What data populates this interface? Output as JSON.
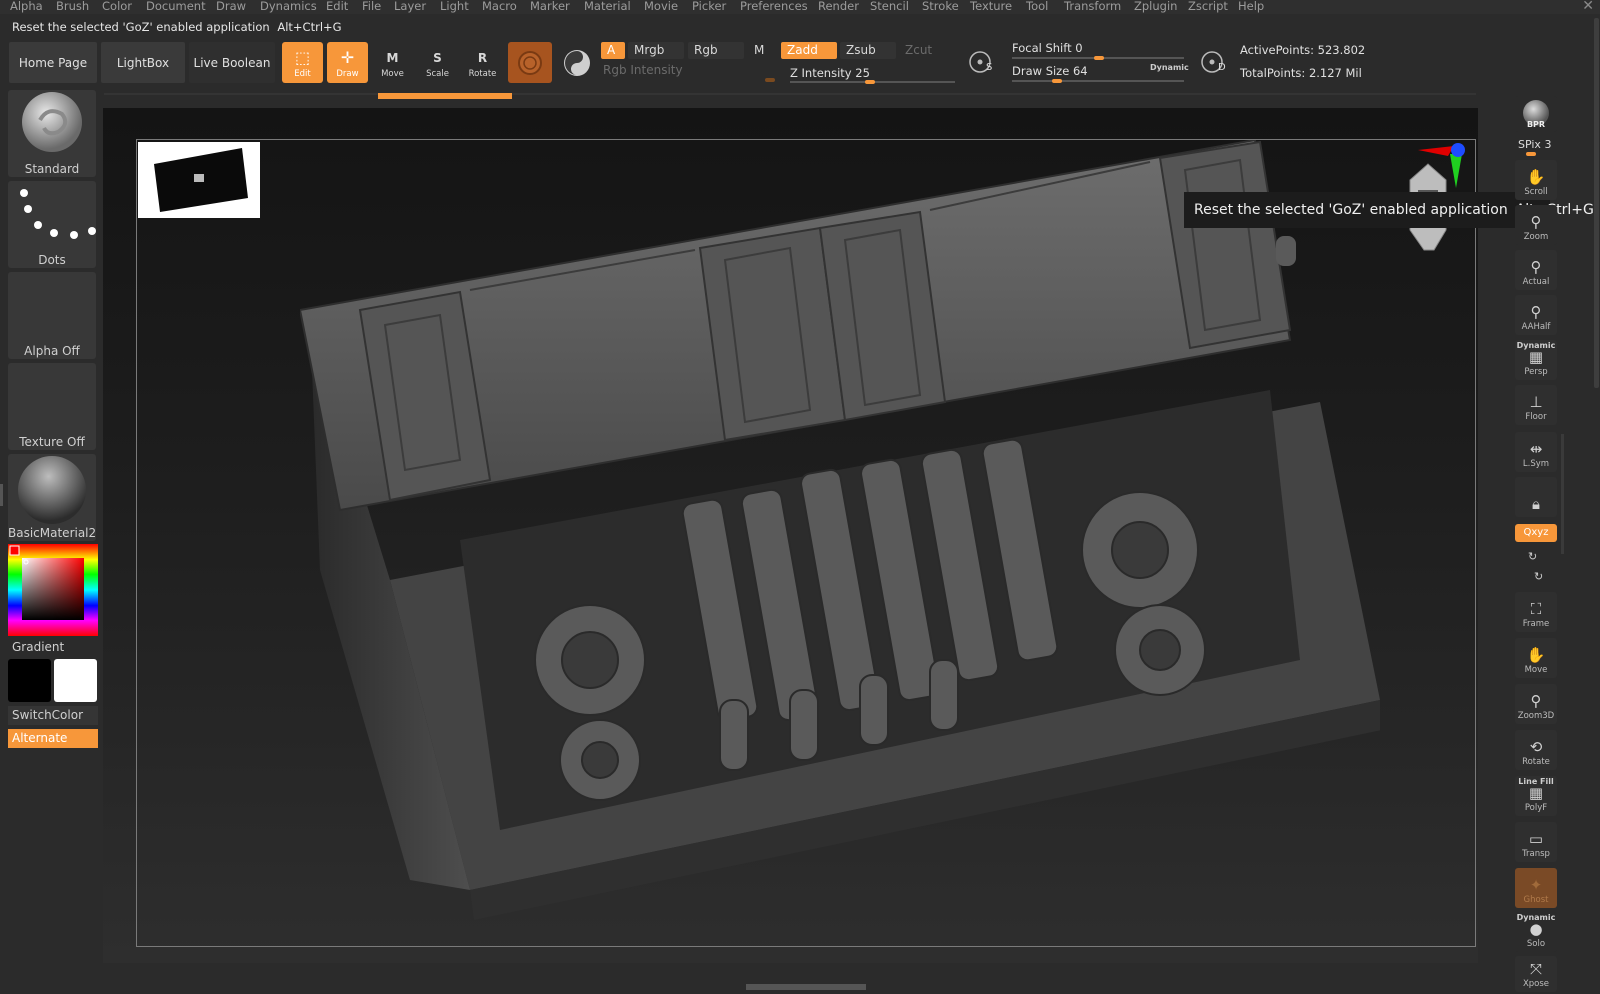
{
  "menu": [
    "Alpha",
    "Brush",
    "Color",
    "Document",
    "Draw",
    "Dynamics",
    "Edit",
    "File",
    "Layer",
    "Light",
    "Macro",
    "Marker",
    "Material",
    "Movie",
    "Picker",
    "Preferences",
    "Render",
    "Stencil",
    "Stroke",
    "Texture",
    "Tool",
    "Transform",
    "Zplugin",
    "Zscript",
    "Help"
  ],
  "status": {
    "message": "Reset the selected 'GoZ' enabled application",
    "shortcut": "Alt+Ctrl+G"
  },
  "nav": {
    "home": "Home Page",
    "lightbox": "LightBox",
    "live_boolean": "Live Boolean"
  },
  "tools": {
    "edit": "Edit",
    "draw": "Draw",
    "move": "Move",
    "scale": "Scale",
    "rotate": "Rotate"
  },
  "tool_letters": {
    "move": "M",
    "scale": "S",
    "rotate": "R"
  },
  "rgb": {
    "a": "A",
    "mrgb": "Mrgb",
    "rgb": "Rgb",
    "m": "M",
    "intensity": "Rgb Intensity"
  },
  "z": {
    "zadd": "Zadd",
    "zsub": "Zsub",
    "zcut": "Zcut",
    "intensity_label": "Z Intensity",
    "intensity_value": "25"
  },
  "focal": {
    "label": "Focal Shift",
    "value": "0"
  },
  "drawsize": {
    "label": "Draw Size",
    "value": "64",
    "dynamic": "Dynamic"
  },
  "points": {
    "active_label": "ActivePoints:",
    "active_value": "523.802",
    "total_label": "TotalPoints:",
    "total_value": "2.127 Mil"
  },
  "sd_letters": {
    "s": "S",
    "d": "D"
  },
  "left": {
    "brush": "Standard",
    "stroke": "Dots",
    "alpha": "Alpha Off",
    "texture": "Texture Off",
    "material": "BasicMaterial2",
    "gradient": "Gradient",
    "switch_color": "SwitchColor",
    "alternate": "Alternate"
  },
  "right": {
    "bpr": "BPR",
    "spix_label": "SPix",
    "spix_value": "3",
    "scroll": "Scroll",
    "zoom": "Zoom",
    "actual": "Actual",
    "aahalf": "AAHalf",
    "persp_top": "Dynamic",
    "persp": "Persp",
    "floor": "Floor",
    "lsym": "L.Sym",
    "xyz": "Qxyz",
    "frame": "Frame",
    "move": "Move",
    "zoom3d": "Zoom3D",
    "rotate": "Rotate",
    "polyf_top": "Line Fill",
    "polyf": "PolyF",
    "transp": "Transp",
    "ghost": "Ghost",
    "solo_top": "Dynamic",
    "solo": "Solo",
    "xpose": "Xpose"
  },
  "tooltip": {
    "text": "Reset the selected 'GoZ' enabled application",
    "shortcut": "Alt+Ctrl+G"
  },
  "colors": {
    "accent": "#f7973a",
    "panel": "#2b2b2b",
    "button": "#3a3a3a"
  }
}
